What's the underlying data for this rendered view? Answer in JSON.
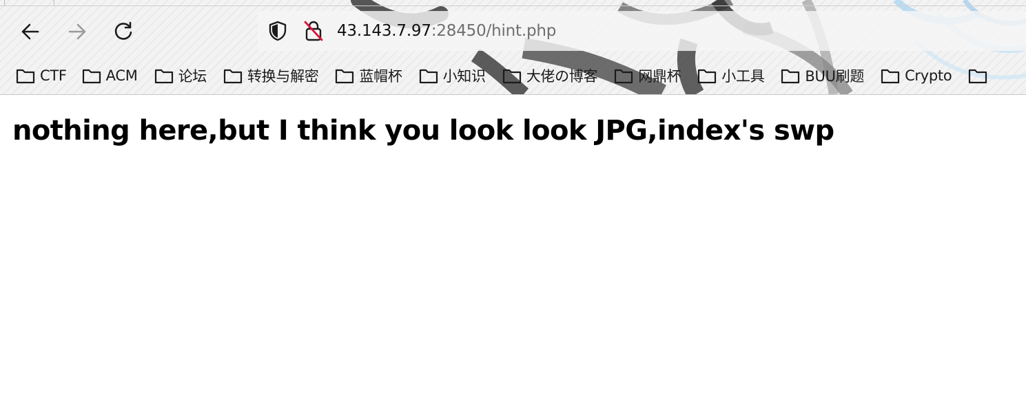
{
  "toolbar": {
    "back_icon": "arrow-left-icon",
    "forward_icon": "arrow-right-icon",
    "reload_icon": "reload-icon"
  },
  "url_bar": {
    "host": "43.143.7.97",
    "rest": ":28450/hint.php",
    "shield_icon": "shield-icon",
    "lock_icon": "insecure-lock-icon"
  },
  "bookmarks": [
    {
      "label": "CTF",
      "icon": "folder-icon"
    },
    {
      "label": "ACM",
      "icon": "folder-icon"
    },
    {
      "label": "论坛",
      "icon": "folder-icon"
    },
    {
      "label": "转换与解密",
      "icon": "folder-icon"
    },
    {
      "label": "蓝帽杯",
      "icon": "folder-icon"
    },
    {
      "label": "小知识",
      "icon": "folder-icon"
    },
    {
      "label": "大佬の博客",
      "icon": "folder-icon"
    },
    {
      "label": "网鼎杯",
      "icon": "folder-icon"
    },
    {
      "label": "小工具",
      "icon": "folder-icon"
    },
    {
      "label": "BUU刷题",
      "icon": "folder-icon"
    },
    {
      "label": "Crypto",
      "icon": "folder-icon"
    },
    {
      "label": "",
      "icon": "folder-icon"
    }
  ],
  "page": {
    "heading": "nothing here,but I think you look look JPG,index's swp"
  },
  "colors": {
    "page_background": "#ffffff",
    "toolbar_background": "#f3f3f3",
    "text": "#000000",
    "url_muted": "#6f6f6f",
    "insecure_red": "#e0103a"
  }
}
